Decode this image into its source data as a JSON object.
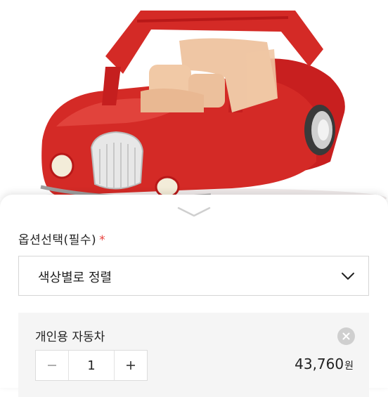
{
  "product_image": {
    "alt": "red toy car",
    "accent_color": "#d42a26"
  },
  "option": {
    "label": "옵션선택(필수)",
    "required_mark": "*",
    "required_color": "#e8413c"
  },
  "sort_select": {
    "value": "색상별로 정렬",
    "icon": "chevron-down-icon"
  },
  "selected_item": {
    "name": "개인용 자동차",
    "quantity": "1",
    "price": "43,760",
    "price_unit": "원",
    "remove_icon": "close-circle-icon",
    "decrease_icon": "minus-icon",
    "increase_icon": "plus-icon"
  },
  "sheet": {
    "handle_icon": "chevron-down-icon"
  }
}
